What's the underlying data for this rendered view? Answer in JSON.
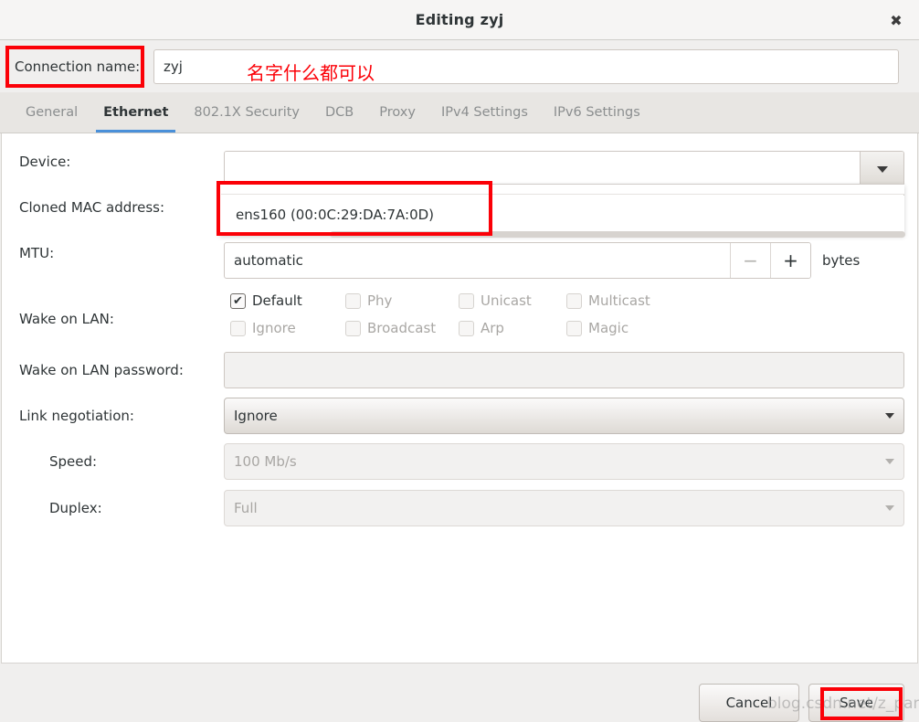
{
  "window": {
    "title": "Editing zyj",
    "close_icon": "close-icon"
  },
  "connection": {
    "label": "Connection name:",
    "value": "zyj",
    "annotation": "名字什么都可以"
  },
  "tabs": [
    {
      "label": "General",
      "active": false
    },
    {
      "label": "Ethernet",
      "active": true
    },
    {
      "label": "802.1X Security",
      "active": false
    },
    {
      "label": "DCB",
      "active": false
    },
    {
      "label": "Proxy",
      "active": false
    },
    {
      "label": "IPv4 Settings",
      "active": false
    },
    {
      "label": "IPv6 Settings",
      "active": false
    }
  ],
  "form": {
    "device": {
      "label": "Device:",
      "value": ""
    },
    "cloned_mac": {
      "label": "Cloned MAC address:",
      "value": ""
    },
    "mtu": {
      "label": "MTU:",
      "value": "automatic",
      "minus": "−",
      "plus": "+",
      "unit": "bytes"
    },
    "wake_on_lan": {
      "label": "Wake on LAN:",
      "options": [
        {
          "label": "Default",
          "checked": true,
          "enabled": true
        },
        {
          "label": "Phy",
          "checked": false,
          "enabled": false
        },
        {
          "label": "Unicast",
          "checked": false,
          "enabled": false
        },
        {
          "label": "Multicast",
          "checked": false,
          "enabled": false
        },
        {
          "label": "Ignore",
          "checked": false,
          "enabled": false
        },
        {
          "label": "Broadcast",
          "checked": false,
          "enabled": false
        },
        {
          "label": "Arp",
          "checked": false,
          "enabled": false
        },
        {
          "label": "Magic",
          "checked": false,
          "enabled": false
        }
      ]
    },
    "wol_password": {
      "label": "Wake on LAN password:",
      "value": ""
    },
    "link_negotiation": {
      "label": "Link negotiation:",
      "value": "Ignore"
    },
    "speed": {
      "label": "Speed:",
      "value": "100 Mb/s"
    },
    "duplex": {
      "label": "Duplex:",
      "value": "Full"
    }
  },
  "device_popup": {
    "items": [
      {
        "label": "ens160 (00:0C:29:DA:7A:0D)"
      }
    ]
  },
  "buttons": {
    "cancel": "Cancel",
    "save": "Save"
  },
  "watermark": "blog.csdn.net/z_pang",
  "colors": {
    "accent": "#4a90d9",
    "annotation_red": "#fb0007",
    "dialog_bg": "#f0efee",
    "content_bg": "#ffffff"
  }
}
